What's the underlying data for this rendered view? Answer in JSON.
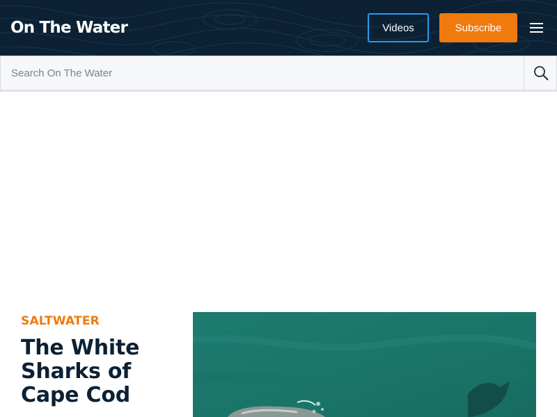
{
  "header": {
    "logo_text": "On The Water",
    "videos_label": "Videos",
    "subscribe_label": "Subscribe",
    "menu_icon": "hamburger-menu-icon"
  },
  "search": {
    "placeholder": "Search On The Water",
    "value": "",
    "icon": "search-icon"
  },
  "featured": {
    "category": "SALTWATER",
    "title": "The White Sharks of Cape Cod"
  },
  "colors": {
    "header_bg": "#0c2133",
    "accent_orange": "#f07a0e",
    "accent_blue": "#2a9bf2",
    "headline": "#0c2133",
    "water": "#1c7a6f"
  }
}
